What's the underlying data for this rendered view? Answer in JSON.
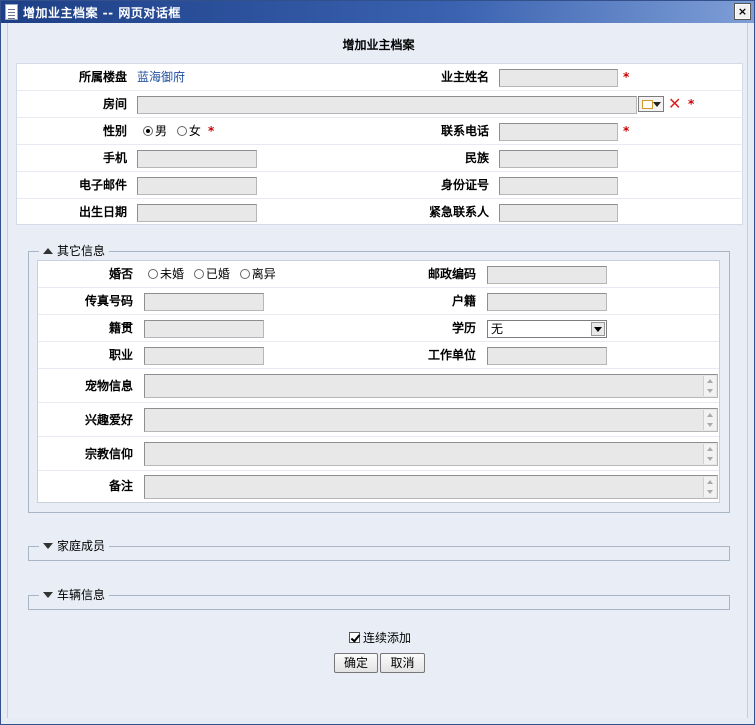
{
  "window": {
    "title": "增加业主档案 -- 网页对话框",
    "close_label": "×"
  },
  "form": {
    "heading": "增加业主档案",
    "building_label": "所属楼盘",
    "building_value": "蓝海御府",
    "owner_name_label": "业主姓名",
    "room_label": "房间",
    "gender_label": "性别",
    "gender_options": [
      "男",
      "女"
    ],
    "gender_selected": "男",
    "phone_label": "联系电话",
    "mobile_label": "手机",
    "ethnicity_label": "民族",
    "email_label": "电子邮件",
    "id_number_label": "身份证号",
    "birthday_label": "出生日期",
    "emergency_contact_label": "紧急联系人",
    "required_mark": "*"
  },
  "other_info": {
    "legend": "其它信息",
    "marital_label": "婚否",
    "marital_options": [
      "未婚",
      "已婚",
      "离异"
    ],
    "postcode_label": "邮政编码",
    "fax_label": "传真号码",
    "household_label": "户籍",
    "native_place_label": "籍贯",
    "education_label": "学历",
    "education_value": "无",
    "occupation_label": "职业",
    "employer_label": "工作单位",
    "pet_label": "宠物信息",
    "hobby_label": "兴趣爱好",
    "religion_label": "宗教信仰",
    "remarks_label": "备注"
  },
  "family": {
    "legend": "家庭成员"
  },
  "vehicle": {
    "legend": "车辆信息"
  },
  "footer": {
    "continuous_add_label": "连续添加",
    "continuous_add_checked": true,
    "confirm_label": "确定",
    "cancel_label": "取消"
  }
}
